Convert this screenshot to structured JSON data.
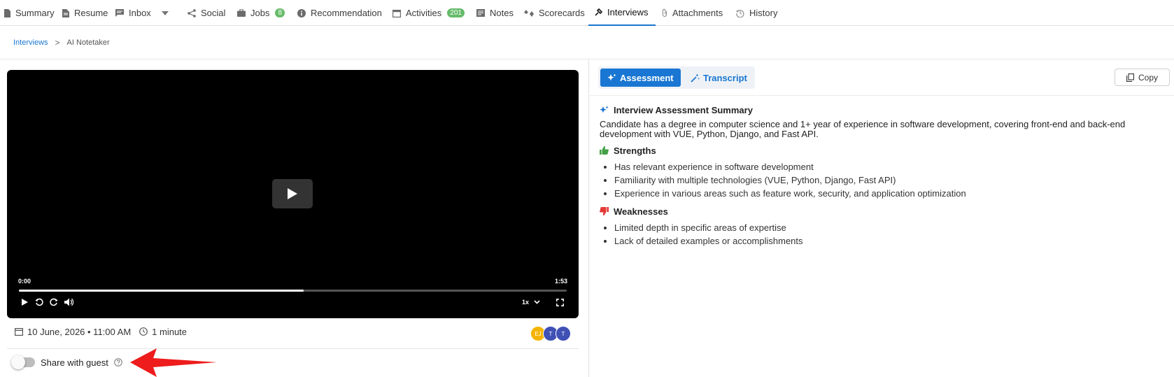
{
  "nav": {
    "tabs": [
      {
        "label": "Summary",
        "icon": "summary-icon"
      },
      {
        "label": "Resume",
        "icon": "resume-icon"
      },
      {
        "label": "Inbox",
        "icon": "inbox-icon"
      },
      {
        "label": "Social",
        "icon": "share-icon"
      },
      {
        "label": "Jobs",
        "icon": "briefcase-icon",
        "badge": "8"
      },
      {
        "label": "Recommendation",
        "icon": "info-icon"
      },
      {
        "label": "Activities",
        "icon": "calendar-icon",
        "badge": "201"
      },
      {
        "label": "Notes",
        "icon": "notes-icon"
      },
      {
        "label": "Scorecards",
        "icon": "scorecard-icon"
      },
      {
        "label": "Interviews",
        "icon": "interview-icon",
        "active": true
      },
      {
        "label": "Attachments",
        "icon": "paperclip-icon"
      },
      {
        "label": "History",
        "icon": "history-icon"
      }
    ],
    "accent": "#1976d2",
    "badge_color": "#66bb6a"
  },
  "breadcrumb": {
    "link": "Interviews",
    "separator": ">",
    "current": "AI Notetaker"
  },
  "video": {
    "time_current": "0:00",
    "time_total": "1:53",
    "progress_fraction": 0.52,
    "speed": "1x"
  },
  "meeting": {
    "date": "10 June, 2026 • 11:00 AM",
    "duration": "1 minute",
    "participants": [
      {
        "initials": "EJ",
        "color": "#f5b400"
      },
      {
        "initials": "T",
        "color": "#3f51b5"
      },
      {
        "initials": "T",
        "color": "#3f51b5"
      }
    ]
  },
  "share": {
    "label": "Share with guest",
    "enabled": false
  },
  "panel": {
    "tabs": {
      "assessment": "Assessment",
      "transcript": "Transcript"
    },
    "copy_label": "Copy",
    "summary_title": "Interview Assessment Summary",
    "summary_text": "Candidate has a degree in computer science and 1+ year of experience in software development, covering front-end and back-end development with VUE, Python, Django, and Fast API.",
    "strengths_title": "Strengths",
    "strengths": [
      "Has relevant experience in software development",
      "Familiarity with multiple technologies (VUE, Python, Django, Fast API)",
      "Experience in various areas such as feature work, security, and application optimization"
    ],
    "weaknesses_title": "Weaknesses",
    "weaknesses": [
      "Limited depth in specific areas of expertise",
      "Lack of detailed examples or accomplishments"
    ],
    "colors": {
      "strength": "#43a047",
      "weakness": "#e53935",
      "sparkle": "#1976d2"
    }
  }
}
